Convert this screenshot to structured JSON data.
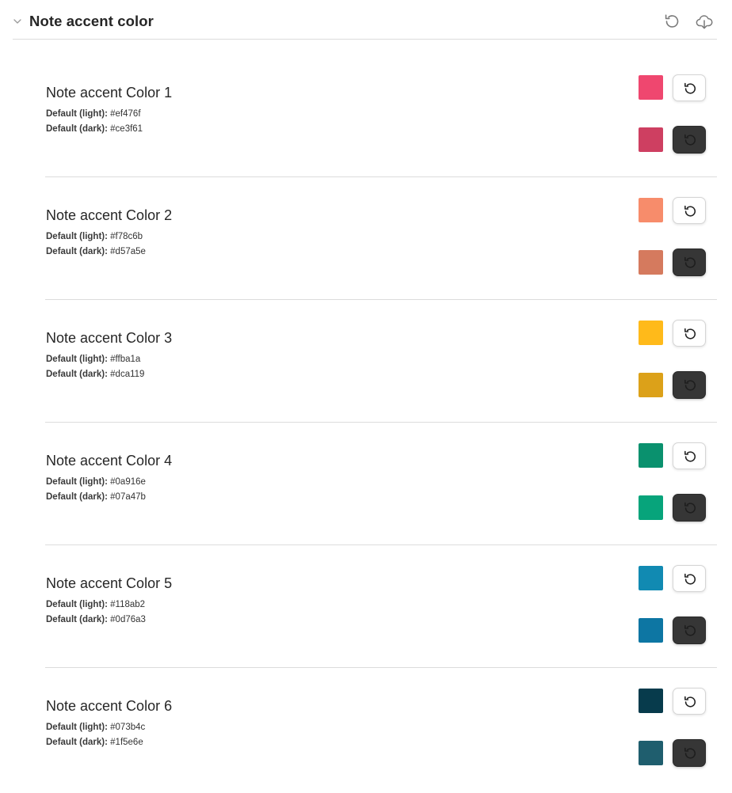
{
  "section": {
    "title": "Note accent color"
  },
  "defaults": {
    "light_label": "Default (light):",
    "dark_label": "Default (dark):"
  },
  "settings": [
    {
      "title": "Note accent Color 1",
      "default_light": "#ef476f",
      "default_dark": "#ce3f61",
      "swatch_light": "#ef476f",
      "swatch_dark": "#ce3f61"
    },
    {
      "title": "Note accent Color 2",
      "default_light": "#f78c6b",
      "default_dark": "#d57a5e",
      "swatch_light": "#f78c6b",
      "swatch_dark": "#d57a5e"
    },
    {
      "title": "Note accent Color 3",
      "default_light": "#ffba1a",
      "default_dark": "#dca119",
      "swatch_light": "#ffba1a",
      "swatch_dark": "#dca119"
    },
    {
      "title": "Note accent Color 4",
      "default_light": "#0a916e",
      "default_dark": "#07a47b",
      "swatch_light": "#0a916e",
      "swatch_dark": "#07a47b"
    },
    {
      "title": "Note accent Color 5",
      "default_light": "#118ab2",
      "default_dark": "#0d76a3",
      "swatch_light": "#118ab2",
      "swatch_dark": "#0d76a3"
    },
    {
      "title": "Note accent Color 6",
      "default_light": "#073b4c",
      "default_dark": "#1f5e6e",
      "swatch_light": "#073b4c",
      "swatch_dark": "#1f5e6e"
    }
  ],
  "icons": {
    "collapse": "chevron-down-icon",
    "header_reset": "reset-icon",
    "header_export": "cloud-download-icon",
    "row_reset": "reset-icon"
  },
  "colors": {
    "reset_button_dark_bg": "#363636",
    "divider": "#dcdcdc"
  }
}
